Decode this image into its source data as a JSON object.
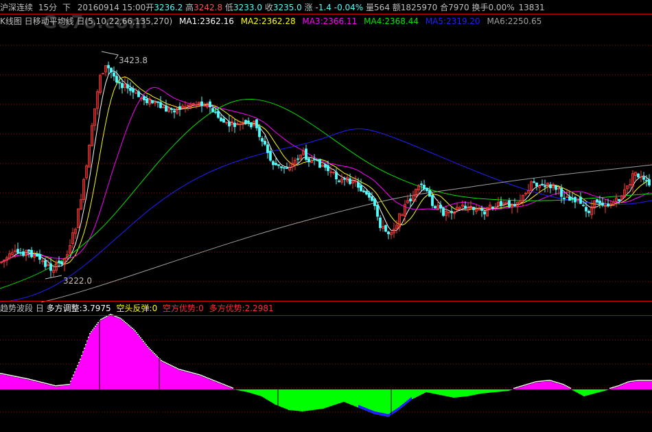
{
  "header": {
    "stock_name": "沪深连续",
    "period": "15分",
    "extra": "下",
    "datetime": "20160914 15:00",
    "open_label": "开",
    "open": "3236.2",
    "high_label": "高",
    "high": "3242.8",
    "low_label": "低",
    "low": "3233.0",
    "close_label": "收",
    "close": "3235.0",
    "change_label": "涨",
    "change": "-1.4",
    "change_pct": "-0.04%",
    "volume_label": "量",
    "volume": "564",
    "amount_label": "额",
    "amount": "1825970",
    "oi_label": "合",
    "oi": "7970",
    "turnover_label": "换手",
    "turnover": "0.00%",
    "extra_value": "13831"
  },
  "ma_row": {
    "title": "K线图 日移动平均线 日(5,10,22,66,135,270)",
    "ma1": "MA1:2362.16",
    "ma2": "MA2:2362.28",
    "ma3": "MA3:2366.11",
    "ma4": "MA4:2368.44",
    "ma5": "MA5:2319.20",
    "ma6": "MA6:2250.65"
  },
  "price_annotations": {
    "high_label": "3423.8",
    "low_label": "3222.0"
  },
  "indicator": {
    "title": "趋势波段 日",
    "adjust": "多方调整:3.7975",
    "rebound": "空头反弹:0",
    "bear": "空方优势:0",
    "bull": "多方优势:2.2981"
  },
  "watermark": "Go7o.com",
  "colors": {
    "up": "#ff3c3c",
    "down": "#54fcfc",
    "ma1": "#ffffff",
    "ma2": "#ffff00",
    "ma3": "#ff00ff",
    "ma4": "#00e600",
    "ma5": "#2020ff",
    "ma6": "#a0a0a0",
    "grid": "#b40000",
    "bull": "#ff00ff",
    "bear": "#00ff00",
    "adjust_text": "#ffffff",
    "bear_text": "#ff3030",
    "bull_text": "#ff3030"
  },
  "chart_data": {
    "type": "candlestick-with-indicator",
    "price_annotations": [
      3423.8,
      3222.0
    ],
    "ma_lines": [
      "MA1",
      "MA2",
      "MA3",
      "MA4",
      "MA5",
      "MA6"
    ],
    "indicator_series": [
      "多方调整",
      "空头反弹",
      "空方优势",
      "多方优势"
    ]
  }
}
